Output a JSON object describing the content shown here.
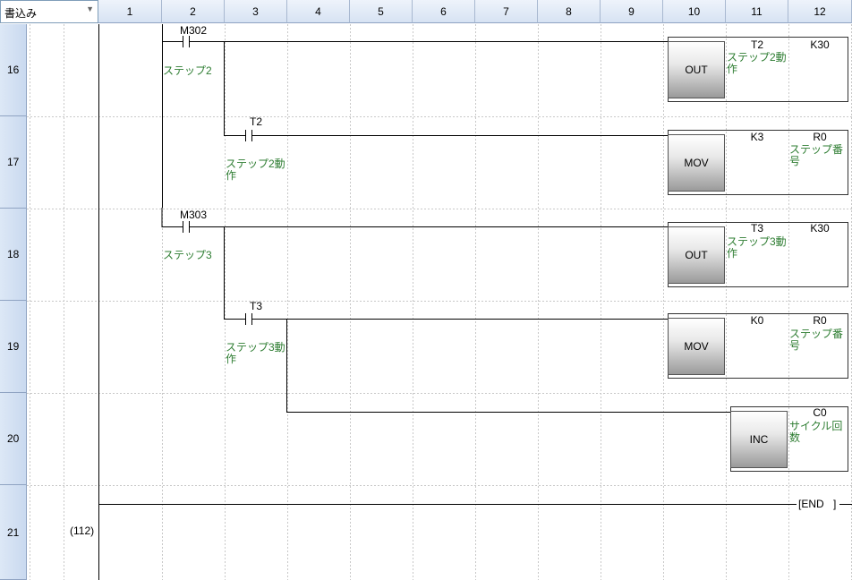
{
  "mode_select": {
    "value": "書込み"
  },
  "columns": [
    "1",
    "2",
    "3",
    "4",
    "5",
    "6",
    "7",
    "8",
    "9",
    "10",
    "11",
    "12"
  ],
  "rows": [
    "16",
    "17",
    "18",
    "19",
    "20",
    "21"
  ],
  "step_number": "(112)",
  "contacts": {
    "m302": "M302",
    "t2": "T2",
    "m303": "M303",
    "t3": "T3"
  },
  "comments": {
    "step2": "ステップ2",
    "step2_action_contact": "ステップ2動作",
    "step3": "ステップ3",
    "step3_action_contact": "ステップ3動作"
  },
  "instructions": {
    "r16": {
      "op": "OUT",
      "device": "T2",
      "device_comment": "ステップ2動作",
      "operand": "K30"
    },
    "r17": {
      "op": "MOV",
      "src": "K3",
      "dst": "R0",
      "dst_comment": "ステップ番号"
    },
    "r18": {
      "op": "OUT",
      "device": "T3",
      "device_comment": "ステップ3動作",
      "operand": "K30"
    },
    "r19": {
      "op": "MOV",
      "src": "K0",
      "dst": "R0",
      "dst_comment": "ステップ番号"
    },
    "r20": {
      "op": "INC",
      "device": "C0",
      "device_comment": "サイクル回数"
    }
  },
  "end_label": "[END",
  "colors": {
    "comment": "#2e7d32",
    "grid_dash": "#c8c8c8",
    "header_bg": "#d7e3f3",
    "line": "#000000"
  }
}
